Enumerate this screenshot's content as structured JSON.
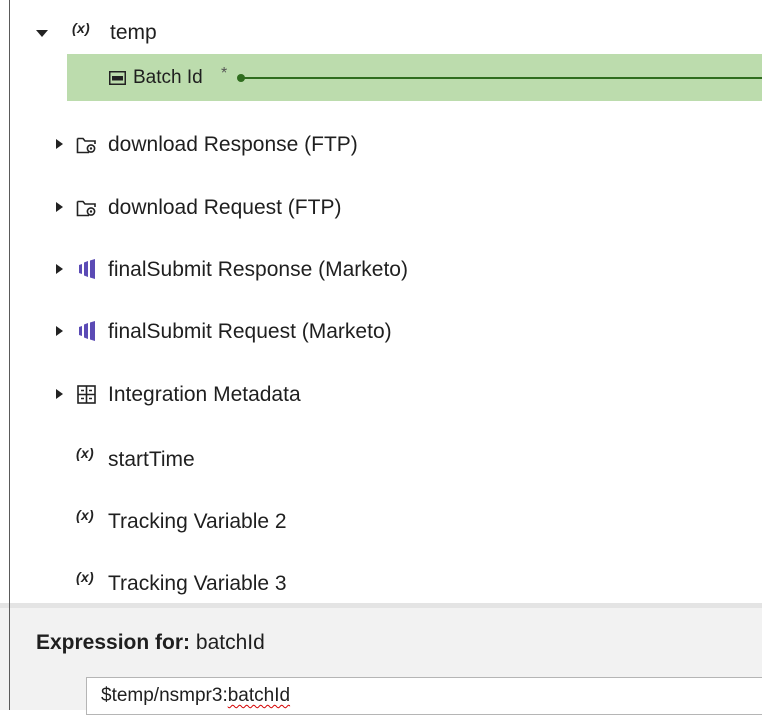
{
  "tree": {
    "temp": {
      "icon": "(x)",
      "label": "temp"
    },
    "batch_id": {
      "label": "Batch Id",
      "required": "*"
    },
    "items": [
      {
        "label": "download Response (FTP)"
      },
      {
        "label": "download Request (FTP)"
      },
      {
        "label": "finalSubmit Response (Marketo)"
      },
      {
        "label": "finalSubmit Request (Marketo)"
      },
      {
        "label": "Integration Metadata"
      }
    ],
    "variables": [
      {
        "icon": "(x)",
        "label": "startTime"
      },
      {
        "icon": "(x)",
        "label": "Tracking Variable 2"
      },
      {
        "icon": "(x)",
        "label": "Tracking Variable 3"
      }
    ]
  },
  "expression": {
    "label_bold": "Expression for:",
    "target": "batchId",
    "value_prefix": "$temp/nsmpr3:",
    "value_error": "batchId"
  },
  "colors": {
    "selection_bg": "#bcdcad",
    "mapping_line": "#2f6d1e",
    "marketo_icon": "#5b4bb5",
    "error_underline": "#d40000"
  },
  "icons": {
    "expand": "caret-right-icon",
    "collapse": "caret-down-icon",
    "variable": "variable-x-icon",
    "string": "string-field-icon",
    "folder_connection": "folder-connection-icon",
    "marketo": "marketo-icon",
    "metadata": "metadata-grid-icon"
  }
}
